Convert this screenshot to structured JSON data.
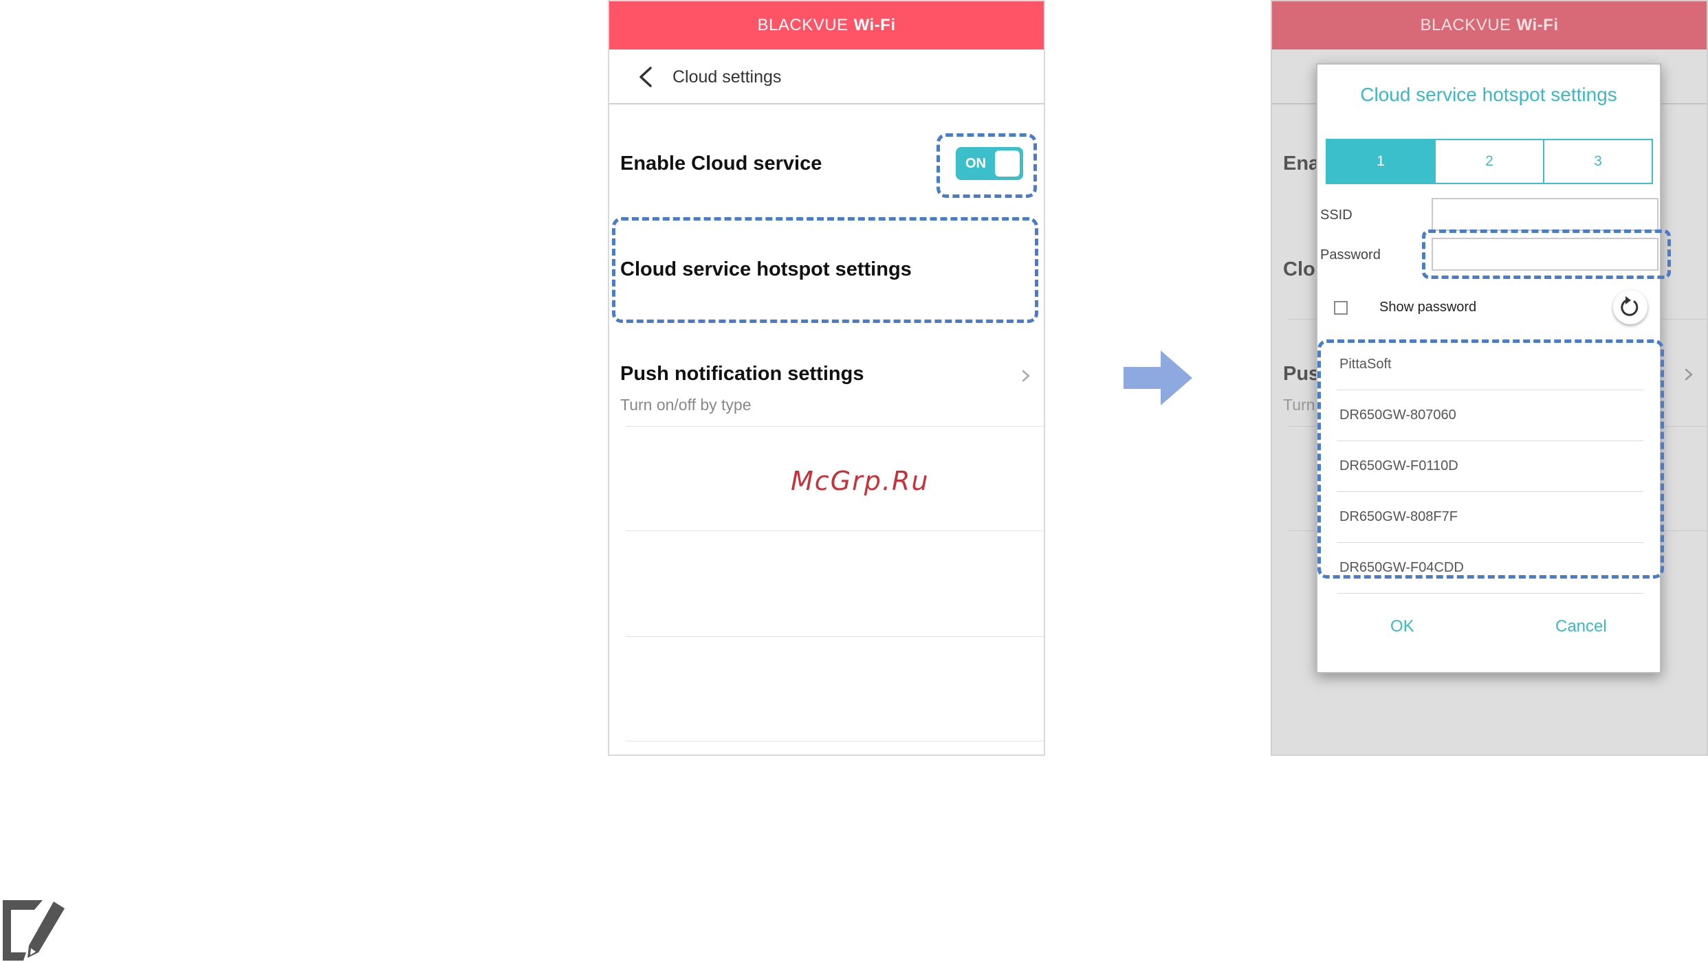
{
  "colors": {
    "header_bg": "#fe5465",
    "header_bg_dimmed": "#d86a77",
    "accent_teal": "#3bbfca",
    "highlight_dash": "#4a7cc8",
    "arrow": "#8ea9e0",
    "watermark": "#c8303a"
  },
  "left_screen": {
    "header": {
      "brand": "BLACKVUE",
      "wifi": "Wi-Fi"
    },
    "back_icon": "chevron-left-icon",
    "title": "Cloud settings",
    "enable_cloud": {
      "label": "Enable Cloud service",
      "toggle_text": "ON",
      "toggle_on": true
    },
    "hotspot": {
      "label": "Cloud service hotspot settings"
    },
    "push": {
      "label": "Push notification settings",
      "sub": "Turn on/off by type"
    },
    "watermark": "McGrp.Ru"
  },
  "arrow_icon": "arrow-right-icon",
  "right_screen": {
    "header": {
      "brand": "BLACKVUE",
      "wifi": "Wi-Fi"
    },
    "background_fragments": {
      "enable": "Ena",
      "cloud": "Clo",
      "push": "Pus",
      "push_sub": "Turn"
    },
    "dialog": {
      "title": "Cloud service hotspot settings",
      "tabs": [
        "1",
        "2",
        "3"
      ],
      "active_tab": "1",
      "ssid_label": "SSID",
      "ssid_value": "",
      "password_label": "Password",
      "password_value": "",
      "show_password_label": "Show password",
      "show_password_checked": false,
      "refresh_icon": "refresh-icon",
      "ssid_list": [
        "PittaSoft",
        "DR650GW-807060",
        "DR650GW-F0110D",
        "DR650GW-808F7F",
        "DR650GW-F04CDD"
      ],
      "ok_label": "OK",
      "cancel_label": "Cancel"
    }
  },
  "note_icon": "note-pencil-icon"
}
